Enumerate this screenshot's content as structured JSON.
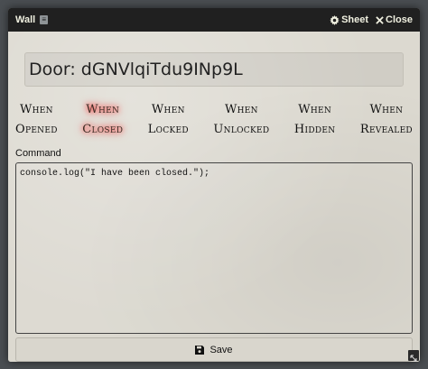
{
  "window": {
    "title": "Wall",
    "badge_icon": "document-icon",
    "sheet_label": "Sheet",
    "close_label": "Close"
  },
  "door_name": "Door: dGNVlqiTdu9INp9L",
  "tabs": [
    {
      "line1": "When",
      "line2": "Opened",
      "active": false
    },
    {
      "line1": "When",
      "line2": "Closed",
      "active": true
    },
    {
      "line1": "When",
      "line2": "Locked",
      "active": false
    },
    {
      "line1": "When",
      "line2": "Unlocked",
      "active": false
    },
    {
      "line1": "When",
      "line2": "Hidden",
      "active": false
    },
    {
      "line1": "When",
      "line2": "Revealed",
      "active": false
    }
  ],
  "command": {
    "label": "Command",
    "value": "console.log(\"I have been closed.\");"
  },
  "save_label": "Save",
  "colors": {
    "titlebar": "#202020",
    "active_glow": "#ff2020"
  }
}
